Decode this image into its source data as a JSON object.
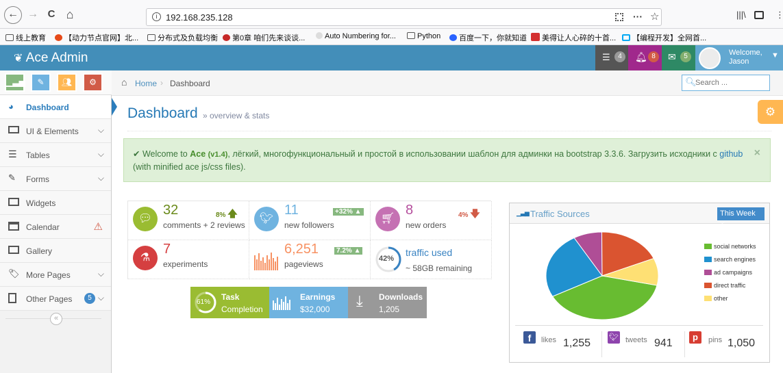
{
  "browser": {
    "back": "←",
    "forward": "→",
    "reload": "C",
    "home": "⌂",
    "url": "192.168.235.128",
    "menu_dots": "···",
    "bookmarks": [
      "线上教育",
      "【动力节点官网】北...",
      "分布式及负载均衡",
      "第0章 咱们先来谈谈...",
      "Auto Numbering for...",
      "Python",
      "百度一下，你就知道",
      "美得让人心碎的十首...",
      "【编程开发】全网首..."
    ]
  },
  "navbar": {
    "brand": "Ace Admin",
    "tasks_count": "4",
    "notifications_count": "8",
    "messages_count": "5",
    "welcome": "Welcome,",
    "user": "Jason"
  },
  "sidebar": {
    "items": [
      {
        "label": "Dashboard"
      },
      {
        "label": "UI & Elements"
      },
      {
        "label": "Tables"
      },
      {
        "label": "Forms"
      },
      {
        "label": "Widgets"
      },
      {
        "label": "Calendar"
      },
      {
        "label": "Gallery"
      },
      {
        "label": "More Pages"
      },
      {
        "label": "Other Pages",
        "badge": "5"
      }
    ],
    "collapse": "«"
  },
  "breadcrumb": {
    "home": "Home",
    "current": "Dashboard"
  },
  "search": {
    "placeholder": "Search ..."
  },
  "page": {
    "title": "Dashboard",
    "subtitle": "» overview & stats"
  },
  "alert": {
    "welcome": "Welcome to",
    "ace": "Ace",
    "version": "(v1.4)",
    "text": ", лёгкий, многофункциональный и простой в использовании шаблон для админки на bootstrap 3.3.6. Загрузить исходники с",
    "link": "github",
    "line2": "(with minified ace js/css files).",
    "close": "×"
  },
  "infoboxes": [
    {
      "number": "32",
      "text": "comments + 2 reviews",
      "stat": "8%",
      "color": "#9abc32"
    },
    {
      "number": "11",
      "text": "new followers",
      "stat": "+32%",
      "color": "#6fb3e0"
    },
    {
      "number": "8",
      "text": "new orders",
      "stat": "4%",
      "color": "#c571b3"
    },
    {
      "number": "7",
      "text": "experiments",
      "color": "#d53f40"
    },
    {
      "number": "6,251",
      "text": "pageviews",
      "stat": "7.2%",
      "color": "#f79263"
    },
    {
      "number": "traffic used",
      "text": "~ 58GB remaining",
      "percent": "42%",
      "color": "#3983c2"
    }
  ],
  "dark_boxes": [
    {
      "percent": "61%",
      "line1": "Task",
      "line2": "Completion",
      "color": "#9abc32"
    },
    {
      "line1": "Earnings",
      "line2": "$32,000",
      "color": "#6fb3e0"
    },
    {
      "line1": "Downloads",
      "line2": "1,205",
      "color": "#999999"
    }
  ],
  "traffic_widget": {
    "title": "Traffic Sources",
    "dropdown": "This Week",
    "social": [
      {
        "label": "likes",
        "value": "1,255",
        "color": "#3b5998"
      },
      {
        "label": "tweets",
        "value": "941",
        "color": "#8e44ad"
      },
      {
        "label": "pins",
        "value": "1,050",
        "color": "#d73d32"
      }
    ]
  },
  "chart_data": {
    "type": "pie",
    "categories": [
      "social networks",
      "search engines",
      "ad campaigns",
      "direct traffic",
      "other"
    ],
    "values": [
      38.7,
      24.5,
      8.2,
      18.6,
      10
    ],
    "colors": [
      "#68bc31",
      "#2091cf",
      "#af4e96",
      "#da5430",
      "#fee074"
    ],
    "legend": "right"
  }
}
